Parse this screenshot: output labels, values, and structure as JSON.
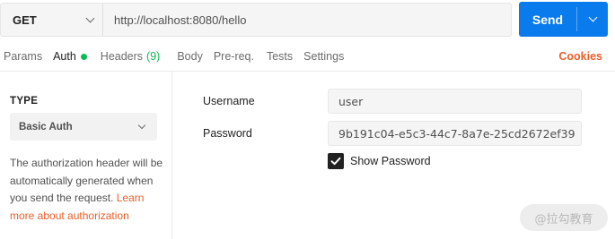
{
  "request": {
    "method": "GET",
    "url": "http://localhost:8080/hello",
    "send_label": "Send"
  },
  "tabs": [
    {
      "label": "Params"
    },
    {
      "label": "Auth",
      "active": true
    },
    {
      "label": "Headers",
      "count": "(9)"
    },
    {
      "label": "Body"
    },
    {
      "label": "Pre-req."
    },
    {
      "label": "Tests"
    },
    {
      "label": "Settings"
    }
  ],
  "cookies_label": "Cookies",
  "auth": {
    "type_label": "TYPE",
    "type_value": "Basic Auth",
    "description": "The authorization header will be automatically generated when you send the request. ",
    "learn_more": "Learn more about authorization",
    "username_label": "Username",
    "username_value": "user",
    "password_label": "Password",
    "password_value": "9b191c04-e5c3-44c7-8a7e-25cd2672ef39",
    "show_password_label": "Show Password",
    "show_password_checked": true
  },
  "watermark": "@拉勾教育",
  "colors": {
    "accent": "#097bed",
    "active_dot": "#0cbb52",
    "link": "#eb5e28"
  }
}
